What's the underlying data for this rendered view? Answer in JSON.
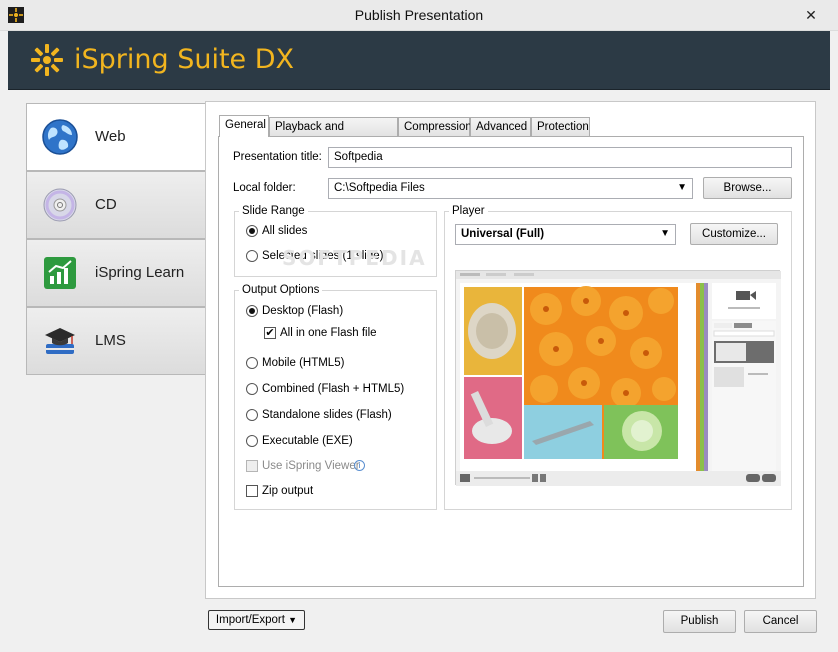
{
  "window": {
    "title": "Publish Presentation",
    "close_glyph": "✕"
  },
  "header": {
    "brand": "iSpring Suite DX"
  },
  "nav": [
    {
      "label": "Web",
      "icon": "globe-icon"
    },
    {
      "label": "CD",
      "icon": "cd-icon"
    },
    {
      "label": "iSpring Learn",
      "icon": "chart-icon"
    },
    {
      "label": "LMS",
      "icon": "graduation-cap-icon"
    }
  ],
  "tabs": [
    "General",
    "Playback and Navigation",
    "Compression",
    "Advanced",
    "Protection"
  ],
  "general": {
    "presentation_title_label": "Presentation title:",
    "presentation_title_value": "Softpedia",
    "local_folder_label": "Local folder:",
    "local_folder_value": "C:\\Softpedia Files",
    "browse_label": "Browse..."
  },
  "slide_range": {
    "title": "Slide Range",
    "all_slides": "All slides",
    "selected_slides": "Selected slides (1 slide)",
    "selected": "all"
  },
  "output_options": {
    "title": "Output Options",
    "desktop": "Desktop (Flash)",
    "all_in_one": "All in one Flash file",
    "mobile": "Mobile (HTML5)",
    "combined": "Combined (Flash + HTML5)",
    "standalone": "Standalone slides (Flash)",
    "executable": "Executable (EXE)",
    "use_viewer": "Use iSpring Viewer",
    "zip": "Zip output",
    "selected": "desktop"
  },
  "player": {
    "title": "Player",
    "selected": "Universal (Full)",
    "customize_label": "Customize..."
  },
  "footer": {
    "import_export": "Import/Export",
    "publish": "Publish",
    "cancel": "Cancel"
  },
  "watermark": "SOFTPEDIA",
  "colors": {
    "brand": "#f2b51f",
    "banner": "#2c3a45"
  }
}
